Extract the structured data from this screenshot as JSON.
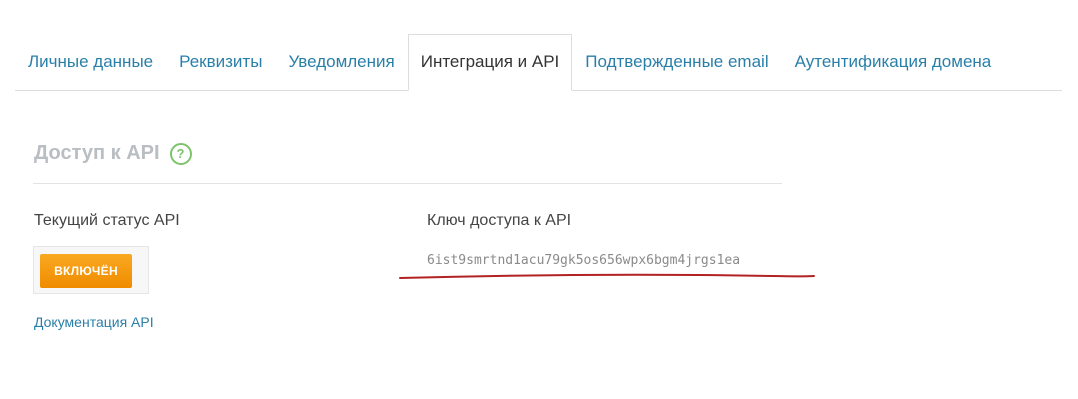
{
  "tabs": [
    {
      "label": "Личные данные"
    },
    {
      "label": "Реквизиты"
    },
    {
      "label": "Уведомления"
    },
    {
      "label": "Интеграция и API"
    },
    {
      "label": "Подтвержденные email"
    },
    {
      "label": "Аутентификация домена"
    }
  ],
  "active_tab": "Интеграция и API",
  "section": {
    "title": "Доступ к API",
    "help_icon": "question-circle-icon",
    "help_glyph": "?"
  },
  "status": {
    "label": "Текущий статус API",
    "button_label": "ВКЛЮЧЁН",
    "doc_link": "Документация API"
  },
  "api_key": {
    "label": "Ключ доступа к API",
    "value": "6ist9smrtnd1acu79gk5os656wpx6bgm4jrgs1ea"
  },
  "colors": {
    "link": "#2a7fa8",
    "button": "#f39c12",
    "help_icon": "#7cc36a",
    "annotation": "#b22222"
  }
}
